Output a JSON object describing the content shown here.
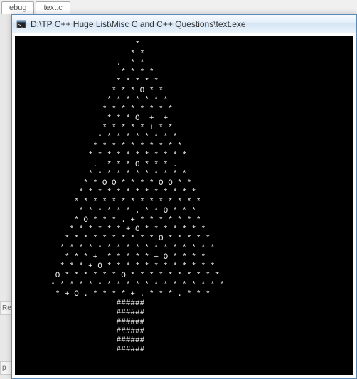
{
  "background": {
    "tab1_label": "ebug",
    "tab2_label": "text.c",
    "side1_label": "Re",
    "side2_label": "p"
  },
  "window": {
    "title": "D:\\TP C++ Huge List\\Misc C and C++ Questions\\text.exe",
    "icon_name": "console-app-icon"
  },
  "console": {
    "tree": [
      "                         *",
      "                        * *",
      "                     .  * *",
      "                      * * * *",
      "                     * * * * *",
      "                    * * * O * *",
      "                   * * * * * * *",
      "                  * * * * * * * *",
      "                   * * * O  +  +",
      "                  * * * * * + * *",
      "                 * * * * * * * * *",
      "                * * * * * * * * * *",
      "               * * * * * * * * * * *",
      "                .  * * * O * * * .",
      "               * * * * * * * * * * *",
      "              * * O O * * * * O O * *",
      "             * * * * * * * * * * * * *",
      "            * * * * * * * * * * * * * *",
      "             * * * * * * . * * O * * *",
      "            * O * * * . + * * * * * * *",
      "           * * * * * * + O * * * * * * *",
      "          * * * * * * * * * * O * * * * *",
      "         * * * * * * * * * * * * * * * * *",
      "          * * * +  * * * * * + O * * * *",
      "         * * * + O * * * * * * * * * * * *",
      "        O * * * * * * O * * * * * * * * * *",
      "       * * * * * * * * * * * * * * * * * * *",
      "        * + O . * * * * + . * * * . * * *",
      "                     ######",
      "                     ######",
      "                     ######",
      "                     ######",
      "                     ######",
      "                     ######"
    ]
  }
}
